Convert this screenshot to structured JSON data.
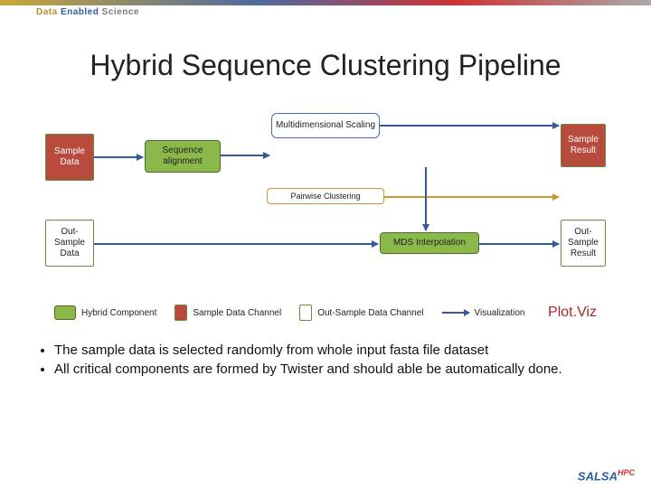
{
  "brand": {
    "part1": "Data ",
    "part2": "Enabled ",
    "part3": "Science"
  },
  "title": "Hybrid Sequence Clustering Pipeline",
  "boxes": {
    "sample_data": "Sample Data",
    "sequence_alignment": "Sequence alignment",
    "mds": "Multidimensional Scaling",
    "pairwise": "Pairwise Clustering",
    "sample_result": "Sample Result",
    "out_data": "Out-Sample Data",
    "mds_interp": "MDS Interpolation",
    "out_result": "Out-Sample Result"
  },
  "legend": {
    "hybrid": "Hybrid Component",
    "sample_channel": "Sample Data Channel",
    "out_channel": "Out-Sample Data Channel",
    "visualization": "Visualization",
    "plotviz": "Plot.Viz"
  },
  "bullets": [
    "The sample data is selected randomly from whole input fasta file dataset",
    "All critical components are formed by Twister and should able be automatically done."
  ],
  "footer": {
    "logo": "SALSA",
    "sub": "HPC"
  }
}
